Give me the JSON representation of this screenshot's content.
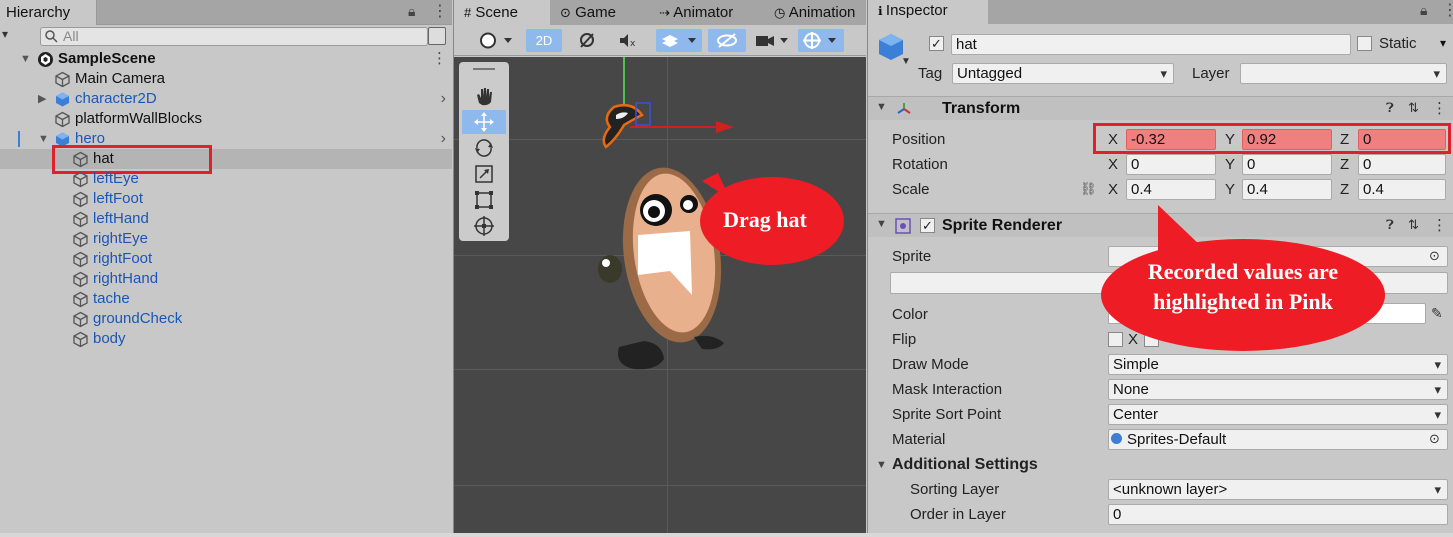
{
  "hierarchy": {
    "tab_label": "Hierarchy",
    "search_placeholder": "All",
    "items": [
      {
        "label": "SampleScene"
      },
      {
        "label": "Main Camera"
      },
      {
        "label": "character2D"
      },
      {
        "label": "platformWallBlocks"
      },
      {
        "label": "hero"
      },
      {
        "label": "hat"
      },
      {
        "label": "leftEye"
      },
      {
        "label": "leftFoot"
      },
      {
        "label": "leftHand"
      },
      {
        "label": "rightEye"
      },
      {
        "label": "rightFoot"
      },
      {
        "label": "rightHand"
      },
      {
        "label": "tache"
      },
      {
        "label": "groundCheck"
      },
      {
        "label": "body"
      }
    ]
  },
  "scene": {
    "tabs": [
      {
        "label": "Scene"
      },
      {
        "label": "Game"
      },
      {
        "label": "Animator"
      },
      {
        "label": "Animation"
      }
    ],
    "toolbar_2d": "2D"
  },
  "inspector": {
    "tab_label": "Inspector",
    "object_name": "hat",
    "static_label": "Static",
    "tag_label": "Tag",
    "tag_value": "Untagged",
    "layer_label": "Layer",
    "layer_value": "",
    "transform": {
      "title": "Transform",
      "position_label": "Position",
      "rotation_label": "Rotation",
      "scale_label": "Scale",
      "axis_x": "X",
      "axis_y": "Y",
      "axis_z": "Z",
      "position": {
        "x": "-0.32",
        "y": "0.92",
        "z": "0"
      },
      "rotation": {
        "x": "0",
        "y": "0",
        "z": "0"
      },
      "scale": {
        "x": "0.4",
        "y": "0.4",
        "z": "0.4"
      },
      "highlight_color": "#f08080"
    },
    "sprite_renderer": {
      "title": "Sprite Renderer",
      "sprite_label": "Sprite",
      "color_label": "Color",
      "flip_label": "Flip",
      "flip_x": "X",
      "draw_mode_label": "Draw Mode",
      "draw_mode_value": "Simple",
      "mask_label": "Mask Interaction",
      "mask_value": "None",
      "sort_point_label": "Sprite Sort Point",
      "sort_point_value": "Center",
      "material_label": "Material",
      "material_value": "Sprites-Default",
      "additional_title": "Additional Settings",
      "sorting_layer_label": "Sorting Layer",
      "sorting_layer_value": "<unknown layer>",
      "order_label": "Order in Layer",
      "order_value": "0"
    }
  },
  "callouts": {
    "drag": "Drag hat",
    "recorded_line1": "Recorded values are",
    "recorded_line2": "highlighted in Pink",
    "color": "#ee1c24"
  }
}
